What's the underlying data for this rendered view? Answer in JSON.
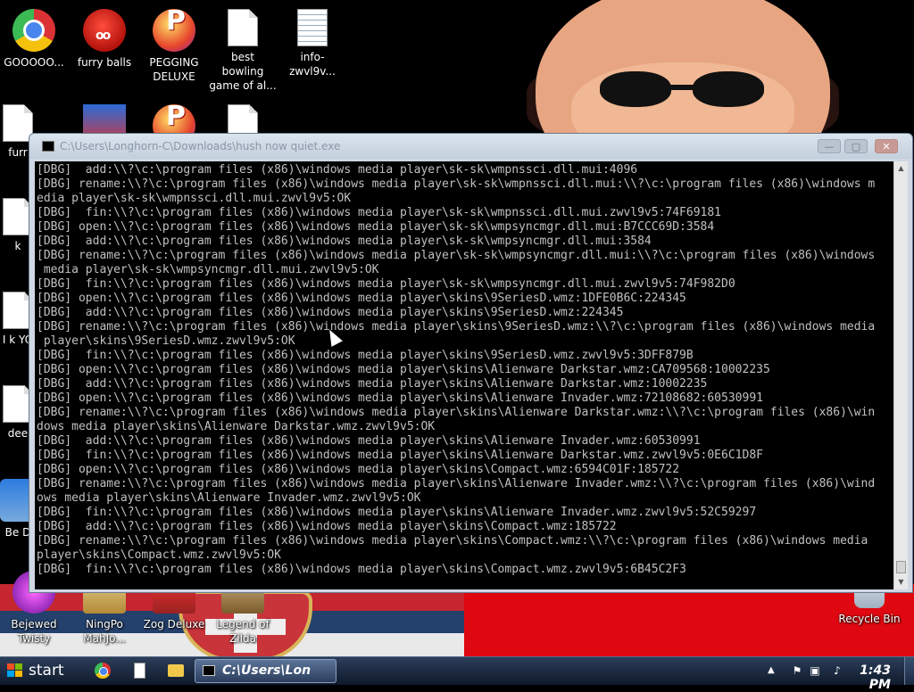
{
  "desktop": {
    "icons": [
      {
        "label": "GOOOOO...",
        "icon": "chrome-icon"
      },
      {
        "label": "furry balls",
        "icon": "fuzzball-icon"
      },
      {
        "label": "PEGGING DELUXE",
        "icon": "peggle-icon"
      },
      {
        "label": "best bowling game of al...",
        "icon": "file-icon"
      },
      {
        "label": "info-zwvl9v...",
        "icon": "text-file-icon"
      },
      {
        "label": "furr",
        "icon": "file-icon"
      },
      {
        "label": "k",
        "icon": "file-icon"
      },
      {
        "label": "I k YO",
        "icon": "file-icon"
      },
      {
        "label": "dee",
        "icon": "file-icon"
      },
      {
        "label": "Be D",
        "icon": "game-icon"
      },
      {
        "label": "Bejewed Twisty",
        "icon": "bejeweled-icon"
      },
      {
        "label": "NingPo MahJo...",
        "icon": "mahjong-icon"
      },
      {
        "label": "Zog Deluxe",
        "icon": "zog-icon"
      },
      {
        "label": "Legend of Zilda",
        "icon": "zelda-icon"
      },
      {
        "label": "Recycle Bin",
        "icon": "recycle-bin-icon"
      }
    ]
  },
  "console": {
    "title": "C:\\Users\\Longhorn-C\\Downloads\\hush now quiet.exe",
    "buttons": {
      "minimize": "—",
      "maximize": "▢",
      "close": "✕"
    },
    "lines": [
      "[DBG]  add:\\\\?\\c:\\program files (x86)\\windows media player\\sk-sk\\wmpnssci.dll.mui:4096",
      "[DBG] rename:\\\\?\\c:\\program files (x86)\\windows media player\\sk-sk\\wmpnssci.dll.mui:\\\\?\\c:\\program files (x86)\\windows m",
      "edia player\\sk-sk\\wmpnssci.dll.mui.zwvl9v5:OK",
      "[DBG]  fin:\\\\?\\c:\\program files (x86)\\windows media player\\sk-sk\\wmpnssci.dll.mui.zwvl9v5:74F69181",
      "[DBG] open:\\\\?\\c:\\program files (x86)\\windows media player\\sk-sk\\wmpsyncmgr.dll.mui:B7CCC69D:3584",
      "[DBG]  add:\\\\?\\c:\\program files (x86)\\windows media player\\sk-sk\\wmpsyncmgr.dll.mui:3584",
      "[DBG] rename:\\\\?\\c:\\program files (x86)\\windows media player\\sk-sk\\wmpsyncmgr.dll.mui:\\\\?\\c:\\program files (x86)\\windows",
      " media player\\sk-sk\\wmpsyncmgr.dll.mui.zwvl9v5:OK",
      "[DBG]  fin:\\\\?\\c:\\program files (x86)\\windows media player\\sk-sk\\wmpsyncmgr.dll.mui.zwvl9v5:74F982D0",
      "[DBG] open:\\\\?\\c:\\program files (x86)\\windows media player\\skins\\9SeriesD.wmz:1DFE0B6C:224345",
      "[DBG]  add:\\\\?\\c:\\program files (x86)\\windows media player\\skins\\9SeriesD.wmz:224345",
      "[DBG] rename:\\\\?\\c:\\program files (x86)\\windows media player\\skins\\9SeriesD.wmz:\\\\?\\c:\\program files (x86)\\windows media",
      " player\\skins\\9SeriesD.wmz.zwvl9v5:OK",
      "[DBG]  fin:\\\\?\\c:\\program files (x86)\\windows media player\\skins\\9SeriesD.wmz.zwvl9v5:3DFF879B",
      "[DBG] open:\\\\?\\c:\\program files (x86)\\windows media player\\skins\\Alienware Darkstar.wmz:CA709568:10002235",
      "[DBG]  add:\\\\?\\c:\\program files (x86)\\windows media player\\skins\\Alienware Darkstar.wmz:10002235",
      "[DBG] open:\\\\?\\c:\\program files (x86)\\windows media player\\skins\\Alienware Invader.wmz:72108682:60530991",
      "[DBG] rename:\\\\?\\c:\\program files (x86)\\windows media player\\skins\\Alienware Darkstar.wmz:\\\\?\\c:\\program files (x86)\\win",
      "dows media player\\skins\\Alienware Darkstar.wmz.zwvl9v5:OK",
      "[DBG]  add:\\\\?\\c:\\program files (x86)\\windows media player\\skins\\Alienware Invader.wmz:60530991",
      "[DBG]  fin:\\\\?\\c:\\program files (x86)\\windows media player\\skins\\Alienware Darkstar.wmz.zwvl9v5:0E6C1D8F",
      "[DBG] open:\\\\?\\c:\\program files (x86)\\windows media player\\skins\\Compact.wmz:6594C01F:185722",
      "[DBG] rename:\\\\?\\c:\\program files (x86)\\windows media player\\skins\\Alienware Invader.wmz:\\\\?\\c:\\program files (x86)\\wind",
      "ows media player\\skins\\Alienware Invader.wmz.zwvl9v5:OK",
      "[DBG]  fin:\\\\?\\c:\\program files (x86)\\windows media player\\skins\\Alienware Invader.wmz.zwvl9v5:52C59297",
      "[DBG]  add:\\\\?\\c:\\program files (x86)\\windows media player\\skins\\Compact.wmz:185722",
      "[DBG] rename:\\\\?\\c:\\program files (x86)\\windows media player\\skins\\Compact.wmz:\\\\?\\c:\\program files (x86)\\windows media",
      "player\\skins\\Compact.wmz.zwvl9v5:OK",
      "[DBG]  fin:\\\\?\\c:\\program files (x86)\\windows media player\\skins\\Compact.wmz.zwvl9v5:6B45C2F3"
    ]
  },
  "taskbar": {
    "start_label": "start",
    "active_task": "C:\\Users\\Lon",
    "clock": "1:43 PM",
    "tray_arrow": "▲",
    "tray_icons": [
      "flag-icon",
      "network-icon",
      "volume-icon"
    ]
  },
  "colors": {
    "console_bg": "#000000",
    "console_text": "#c0c0c0",
    "taskbar": "#1b2a42",
    "wallpaper_red": "#e00810"
  }
}
